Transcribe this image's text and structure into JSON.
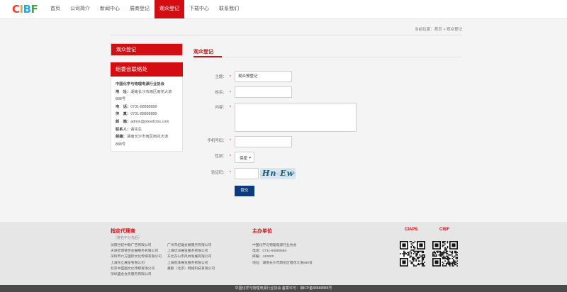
{
  "brand": {
    "logo_letters": [
      "C",
      "I",
      "B",
      "F"
    ],
    "logo_colors": [
      "#e9402d",
      "#f3a12b",
      "#28a8e0",
      "#3aa845"
    ],
    "accent": "#d40d12",
    "button_blue": "#0b3a7e"
  },
  "nav": [
    {
      "label": "首页",
      "active": false
    },
    {
      "label": "公司简介",
      "active": false
    },
    {
      "label": "新闻中心",
      "active": false
    },
    {
      "label": "展商登记",
      "active": false
    },
    {
      "label": "观众登记",
      "active": true
    },
    {
      "label": "下载中心",
      "active": false
    },
    {
      "label": "联系我们",
      "active": false
    }
  ],
  "breadcrumb": {
    "prefix": "当前位置：",
    "home": "首页",
    "sep": " > ",
    "current": "观众登记"
  },
  "sidebar": {
    "menu_title": "观众登记",
    "contact_title": "组委会联络处",
    "org": "中国化学与物理电源行业协会",
    "lines": [
      {
        "k": "地　址：",
        "v": "湖南长沙市雨区雨花大道"
      },
      {
        "k": "",
        "v": "888号"
      },
      {
        "k": "电　话：",
        "v": "0731-88888888"
      },
      {
        "k": "传　真：",
        "v": "0731-88888888"
      },
      {
        "k": "邮　箱：",
        "v": "admin@pbootcms.com"
      },
      {
        "k": "联系人：",
        "v": "谢先生"
      },
      {
        "k": "邮编：",
        "v": "湖南长沙市雨区雨花大道"
      },
      {
        "k": "",
        "v": "888号"
      }
    ]
  },
  "form": {
    "title": "观众登记",
    "subject_label": "主题：",
    "subject_value": "观众预登记",
    "name_label": "姓名：",
    "content_label": "内容：",
    "phone_label": "手机号码：",
    "gender_label": "性别：",
    "gender_value": "保密",
    "captcha_label": "验证码：",
    "captcha_text": "Hn Ew",
    "required_mark": "*",
    "submit_label": "提交"
  },
  "footer": {
    "agent_title": "指定代理商",
    "agent_sub": "（排名不分先后）",
    "agents_col1": [
      "沈阳世纪中联广告有限公司",
      "天津智博德世会展服务有限公司",
      "深圳市六方国际文化传媒有限公司",
      "上海东立展览有限公司",
      "北京中盛国文化传媒有限公司",
      "深圳盛会会务服务有限公司"
    ],
    "agents_col2": [
      "广州市纪雄会展服务有限公司",
      "上海优派展览服务有限公司",
      "东北东山市风林发展有限公司",
      "上海劲泽展览服务有限公司",
      "鑫毅（北京）网络科技有限公司"
    ],
    "host_title": "主办单位",
    "host_lines": [
      "中国化学与物理电源行业协会",
      "电话：0731-88888888",
      "邮编：410000",
      "地址：湖南长沙市雨花区雨花大道888号"
    ],
    "qr1_label": "CIAPS",
    "qr2_label": "CIBF",
    "copyright": "中国化学与物理电源行业协会 备案许可：湘ICP备88888888号"
  }
}
